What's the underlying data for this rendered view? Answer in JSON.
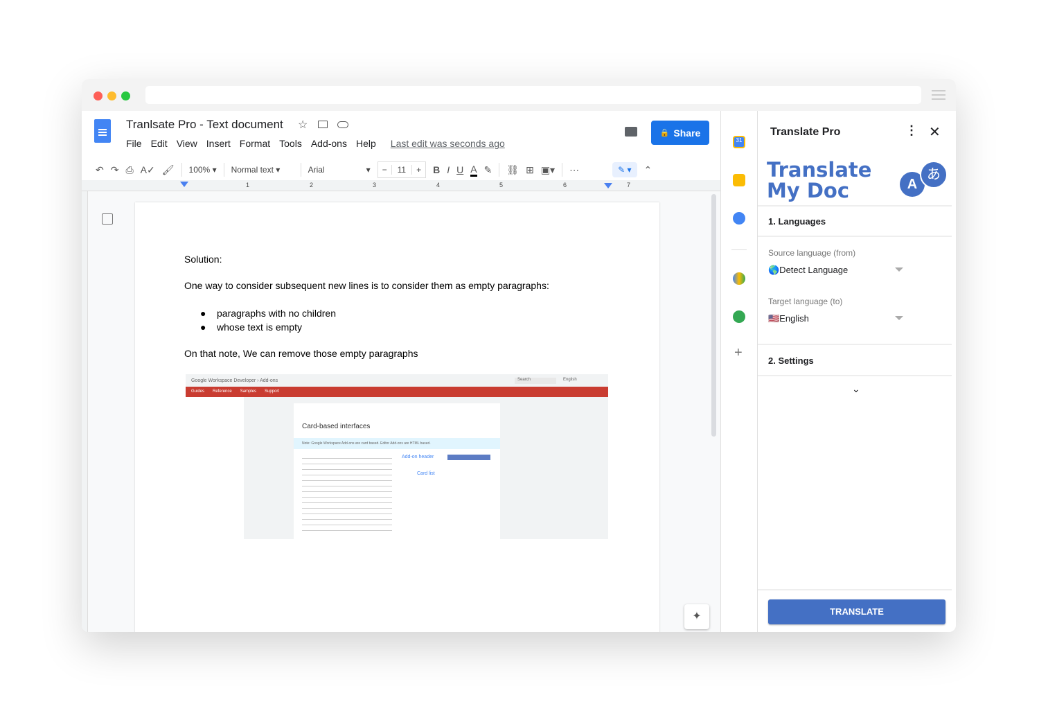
{
  "doc": {
    "title": "Tranlsate Pro - Text document",
    "menus": [
      "File",
      "Edit",
      "View",
      "Insert",
      "Format",
      "Tools",
      "Add-ons",
      "Help"
    ],
    "last_edit": "Last edit was seconds ago",
    "share": "Share"
  },
  "toolbar": {
    "zoom": "100%",
    "style": "Normal text",
    "font": "Arial",
    "size": "11",
    "ruler_marks": [
      "1",
      "2",
      "3",
      "4",
      "5",
      "6",
      "7"
    ]
  },
  "content": {
    "heading": "Solution:",
    "para1": "One way to consider subsequent new lines is to consider them as empty paragraphs:",
    "bullets": [
      "paragraphs with no children",
      "whose text is empty"
    ],
    "para2": "On that note, We can remove those empty paragraphs"
  },
  "embedded": {
    "breadcrumb": "Google Workspace Developer › Add-ons",
    "nav": [
      "Guides",
      "Reference",
      "Samples",
      "Support"
    ],
    "title": "Card-based interfaces",
    "label_header": "Add-on header",
    "label_cards": "Card list",
    "note": "Note: Google Workspace Add-ons are card based. Editor Add-ons are HTML based.",
    "search": "Search",
    "lang": "English"
  },
  "panel": {
    "title": "Translate Pro",
    "logo_line1": "Translate",
    "logo_line2": "My Doc",
    "section1": "1. Languages",
    "source_label": "Source language (from)",
    "source_value": "🌎Detect Language",
    "target_label": "Target language (to)",
    "target_value": "🇺🇸English",
    "section2": "2. Settings",
    "translate": "TRANSLATE"
  },
  "colors": {
    "accent": "#4470c4",
    "share": "#1a73e8",
    "embedded_bar": "#c93c31"
  }
}
